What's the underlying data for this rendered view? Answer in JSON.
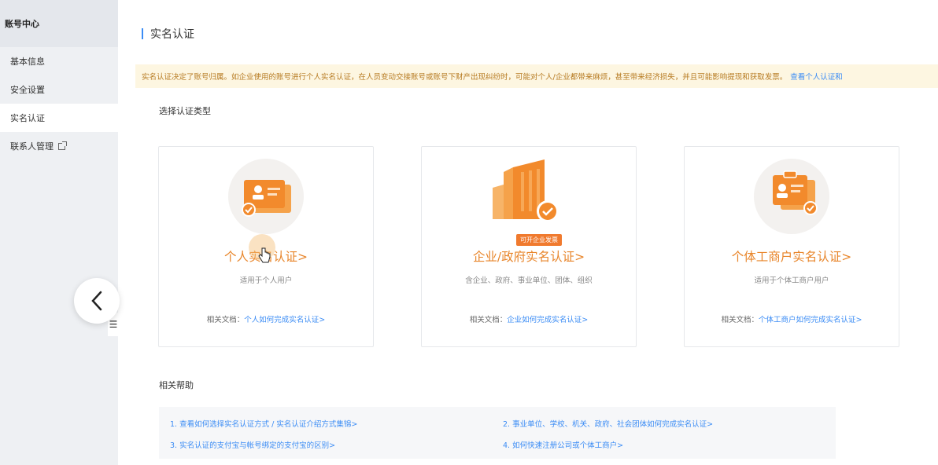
{
  "sidebar": {
    "title": "账号中心",
    "items": [
      {
        "label": "基本信息"
      },
      {
        "label": "安全设置"
      },
      {
        "label": "实名认证"
      },
      {
        "label": "联系人管理"
      }
    ]
  },
  "page": {
    "title": "实名认证",
    "notice_text": "实名认证决定了账号归属。如企业使用的账号进行个人实名认证，在人员变动交接账号或账号下财产出现纠纷时，可能对个人/企业都带来麻烦，甚至带来经济损失，并且可能影响提现和获取发票。",
    "notice_link": "查看个人认证和"
  },
  "select_label": "选择认证类型",
  "cards": [
    {
      "title": "个人实名认证>",
      "subtitle": "适用于个人用户",
      "doc_prefix": "相关文档：",
      "doc_link": "个人如何完成实名认证>"
    },
    {
      "badge": "可开企业发票",
      "title": "企业/政府实名认证>",
      "subtitle": "含企业、政府、事业单位、团体、组织",
      "doc_prefix": "相关文档：",
      "doc_link": "企业如何完成实名认证>"
    },
    {
      "title": "个体工商户实名认证>",
      "subtitle": "适用于个体工商户用户",
      "doc_prefix": "相关文档：",
      "doc_link": "个体工商户如何完成实名认证>"
    }
  ],
  "help": {
    "label": "相关帮助",
    "links": [
      "1. 查看如何选择实名认证方式 / 实名认证介绍方式集锦>",
      "2. 事业单位、学校、机关、政府、社会团体如何完成实名认证>",
      "3. 实名认证的支付宝与帐号绑定的支付宝的区别>",
      "4. 如何快速注册公司或个体工商户>"
    ]
  },
  "colors": {
    "accent_orange": "#e8852a",
    "link_blue": "#3b8cf5",
    "notice_bg": "#fdf6e1"
  }
}
